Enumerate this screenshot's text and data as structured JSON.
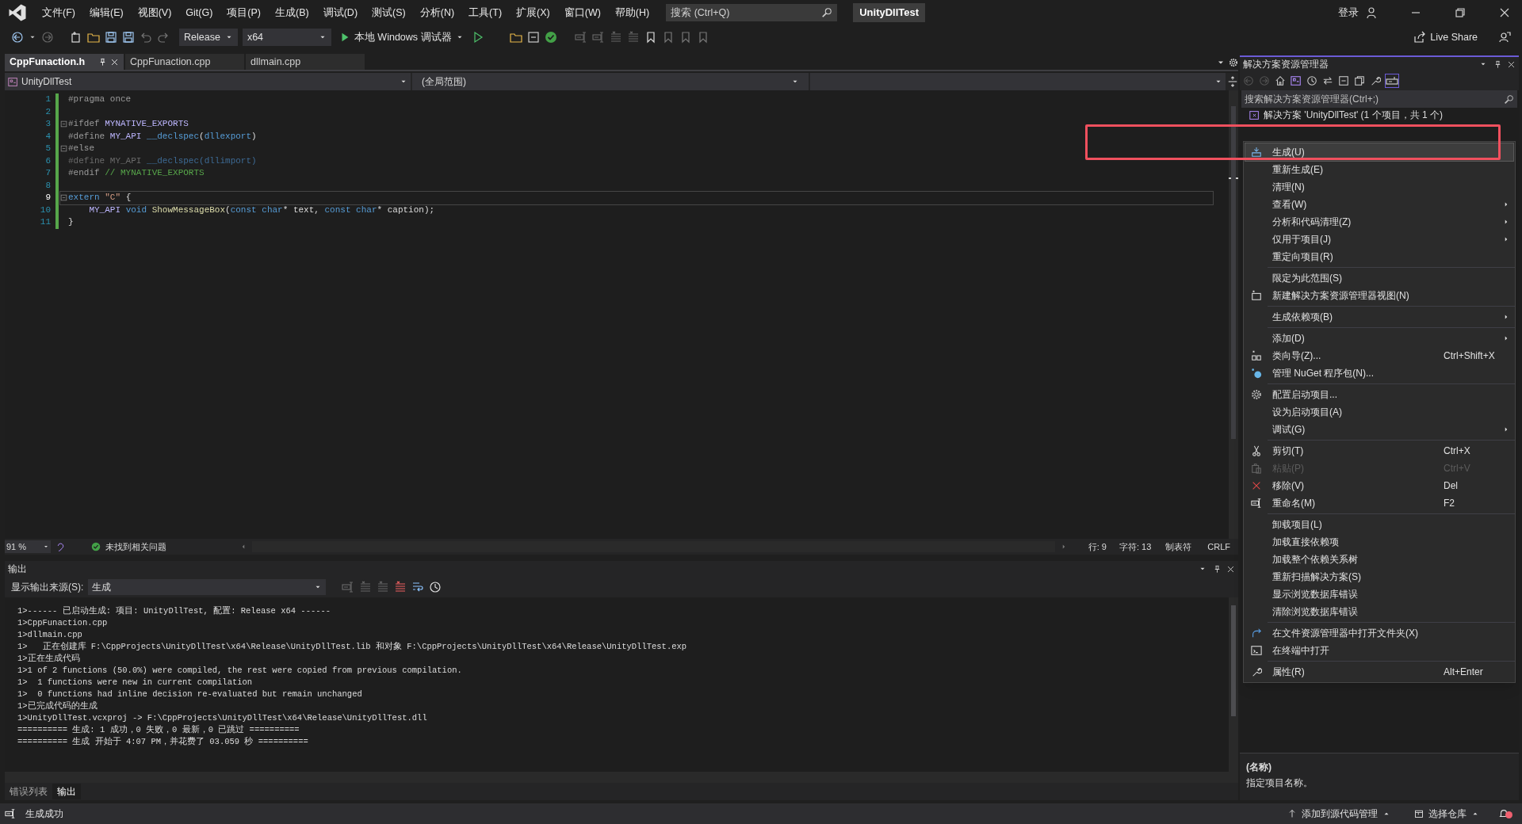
{
  "title_bar": {
    "menus": [
      "文件(F)",
      "编辑(E)",
      "视图(V)",
      "Git(G)",
      "项目(P)",
      "生成(B)",
      "调试(D)",
      "测试(S)",
      "分析(N)",
      "工具(T)",
      "扩展(X)",
      "窗口(W)",
      "帮助(H)"
    ],
    "search_placeholder": "搜索 (Ctrl+Q)",
    "solution_name": "UnityDllTest",
    "sign_in": "登录"
  },
  "toolbar": {
    "configuration": "Release",
    "platform": "x64",
    "run_target": "本地 Windows 调试器",
    "live_share": "Live Share"
  },
  "doc_tabs": [
    {
      "label": "CppFunaction.h",
      "selected": true
    },
    {
      "label": "CppFunaction.cpp",
      "selected": false
    },
    {
      "label": "dllmain.cpp",
      "selected": false
    }
  ],
  "nav_bar": {
    "project": "UnityDllTest",
    "scope": "(全局范围)"
  },
  "code": [
    {
      "number": "1",
      "current": false,
      "fold": false,
      "segments": [
        {
          "kind": "pre",
          "text": "#pragma once"
        }
      ]
    },
    {
      "number": "2",
      "current": false,
      "fold": false
    },
    {
      "number": "3",
      "current": false,
      "fold": true,
      "segments": [
        {
          "kind": "pre",
          "text": "#ifdef "
        },
        {
          "kind": "macro",
          "text": "MYNATIVE_EXPORTS"
        }
      ]
    },
    {
      "number": "4",
      "current": false,
      "fold": false,
      "segments": [
        {
          "kind": "pre",
          "text": "#define "
        },
        {
          "kind": "macro",
          "text": "MY_API "
        },
        {
          "kind": "kw",
          "text": "__declspec"
        },
        {
          "kind": "plain",
          "text": "("
        },
        {
          "kind": "kw",
          "text": "dllexport"
        },
        {
          "kind": "plain",
          "text": ")"
        }
      ]
    },
    {
      "number": "5",
      "current": false,
      "fold": true,
      "segments": [
        {
          "kind": "pre",
          "text": "#else"
        }
      ]
    },
    {
      "number": "6",
      "current": false,
      "fold": false,
      "segments": [
        {
          "kind": "inactive",
          "text": "#define MY_API "
        },
        {
          "kind": "inactive_kw",
          "text": "__declspec(dllimport)"
        }
      ]
    },
    {
      "number": "7",
      "current": false,
      "fold": false,
      "segments": [
        {
          "kind": "pre",
          "text": "#endif "
        },
        {
          "kind": "comment",
          "text": "// MYNATIVE_EXPORTS"
        }
      ]
    },
    {
      "number": "8",
      "current": false,
      "fold": false
    },
    {
      "number": "9",
      "current": true,
      "fold": true,
      "segments": [
        {
          "kind": "kw",
          "text": "extern "
        },
        {
          "kind": "string",
          "text": "\"C\""
        },
        {
          "kind": "plain",
          "text": " {"
        }
      ]
    },
    {
      "number": "10",
      "current": false,
      "fold": false,
      "segments": [
        {
          "kind": "macro",
          "text": "    MY_API "
        },
        {
          "kind": "kw",
          "text": "void "
        },
        {
          "kind": "func",
          "text": "ShowMessageBox"
        },
        {
          "kind": "plain",
          "text": "("
        },
        {
          "kind": "kw",
          "text": "const char"
        },
        {
          "kind": "plain",
          "text": "* text, "
        },
        {
          "kind": "kw",
          "text": "const char"
        },
        {
          "kind": "plain",
          "text": "* caption);"
        }
      ]
    },
    {
      "number": "11",
      "current": false,
      "fold": false,
      "segments": [
        {
          "kind": "plain",
          "text": "}"
        }
      ]
    }
  ],
  "editor_status": {
    "zoom": "91 %",
    "issues": "未找到相关问题",
    "line": "行: 9",
    "column": "字符: 13",
    "indent": "制表符",
    "line_ending": "CRLF"
  },
  "output": {
    "title": "输出",
    "source_label": "显示输出来源(S):",
    "source": "生成",
    "lines": [
      "1>------ 已启动生成: 项目: UnityDllTest, 配置: Release x64 ------",
      "1>CppFunaction.cpp",
      "1>dllmain.cpp",
      "1>   正在创建库 F:\\CppProjects\\UnityDllTest\\x64\\Release\\UnityDllTest.lib 和对象 F:\\CppProjects\\UnityDllTest\\x64\\Release\\UnityDllTest.exp",
      "1>正在生成代码",
      "1>1 of 2 functions (50.0%) were compiled, the rest were copied from previous compilation.",
      "1>  1 functions were new in current compilation",
      "1>  0 functions had inline decision re-evaluated but remain unchanged",
      "1>已完成代码的生成",
      "1>UnityDllTest.vcxproj -> F:\\CppProjects\\UnityDllTest\\x64\\Release\\UnityDllTest.dll",
      "========== 生成: 1 成功，0 失败，0 最新，0 已跳过 ==========",
      "========== 生成 开始于 4:07 PM，并花费了 03.059 秒 =========="
    ]
  },
  "bottom_tabs": [
    {
      "label": "错误列表",
      "selected": false
    },
    {
      "label": "输出",
      "selected": true
    }
  ],
  "status_bar": {
    "message": "生成成功",
    "source_control": "添加到源代码管理",
    "repository": "选择仓库"
  },
  "solution_explorer": {
    "title": "解决方案资源管理器",
    "search_placeholder": "搜索解决方案资源管理器(Ctrl+;)",
    "tree": [
      {
        "label": "解决方案 'UnityDllTest' (1 个项目，共 1 个)"
      }
    ]
  },
  "context_menu": [
    {
      "kind": "item",
      "label": "生成(U)",
      "selected": true,
      "disabled": false,
      "submenu": false
    },
    {
      "kind": "item",
      "label": "重新生成(E)",
      "selected": false,
      "disabled": false,
      "submenu": false
    },
    {
      "kind": "item",
      "label": "清理(N)",
      "selected": false,
      "disabled": false,
      "submenu": false
    },
    {
      "kind": "item",
      "label": "查看(W)",
      "selected": false,
      "disabled": false,
      "submenu": true
    },
    {
      "kind": "item",
      "label": "分析和代码清理(Z)",
      "selected": false,
      "disabled": false,
      "submenu": true
    },
    {
      "kind": "item",
      "label": "仅用于项目(J)",
      "selected": false,
      "disabled": false,
      "submenu": true
    },
    {
      "kind": "item",
      "label": "重定向项目(R)",
      "selected": false,
      "disabled": false,
      "submenu": false
    },
    {
      "kind": "separator"
    },
    {
      "kind": "item",
      "label": "限定为此范围(S)",
      "selected": false,
      "disabled": false,
      "submenu": false
    },
    {
      "kind": "item",
      "label": "新建解决方案资源管理器视图(N)",
      "selected": false,
      "disabled": false,
      "submenu": false
    },
    {
      "kind": "separator"
    },
    {
      "kind": "item",
      "label": "生成依赖项(B)",
      "selected": false,
      "disabled": false,
      "submenu": true
    },
    {
      "kind": "separator"
    },
    {
      "kind": "item",
      "label": "添加(D)",
      "selected": false,
      "disabled": false,
      "submenu": true
    },
    {
      "kind": "item",
      "label": "类向导(Z)...",
      "shortcut": "Ctrl+Shift+X",
      "selected": false,
      "disabled": false,
      "submenu": false
    },
    {
      "kind": "item",
      "label": "管理 NuGet 程序包(N)...",
      "selected": false,
      "disabled": false,
      "submenu": false
    },
    {
      "kind": "separator"
    },
    {
      "kind": "item",
      "label": "配置启动项目...",
      "selected": false,
      "disabled": false,
      "submenu": false
    },
    {
      "kind": "item",
      "label": "设为启动项目(A)",
      "selected": false,
      "disabled": false,
      "submenu": false
    },
    {
      "kind": "item",
      "label": "调试(G)",
      "selected": false,
      "disabled": false,
      "submenu": true
    },
    {
      "kind": "separator"
    },
    {
      "kind": "item",
      "label": "剪切(T)",
      "shortcut": "Ctrl+X",
      "selected": false,
      "disabled": false,
      "submenu": false
    },
    {
      "kind": "item",
      "label": "粘贴(P)",
      "shortcut": "Ctrl+V",
      "selected": false,
      "disabled": true,
      "submenu": false
    },
    {
      "kind": "item",
      "label": "移除(V)",
      "shortcut": "Del",
      "selected": false,
      "disabled": false,
      "submenu": false
    },
    {
      "kind": "item",
      "label": "重命名(M)",
      "shortcut": "F2",
      "selected": false,
      "disabled": false,
      "submenu": false
    },
    {
      "kind": "separator"
    },
    {
      "kind": "item",
      "label": "卸载项目(L)",
      "selected": false,
      "disabled": false,
      "submenu": false
    },
    {
      "kind": "item",
      "label": "加载直接依赖项",
      "selected": false,
      "disabled": false,
      "submenu": false
    },
    {
      "kind": "item",
      "label": "加载整个依赖关系树",
      "selected": false,
      "disabled": false,
      "submenu": false
    },
    {
      "kind": "item",
      "label": "重新扫描解决方案(S)",
      "selected": false,
      "disabled": false,
      "submenu": false
    },
    {
      "kind": "item",
      "label": "显示浏览数据库错误",
      "selected": false,
      "disabled": false,
      "submenu": false
    },
    {
      "kind": "item",
      "label": "清除浏览数据库错误",
      "selected": false,
      "disabled": false,
      "submenu": false
    },
    {
      "kind": "separator"
    },
    {
      "kind": "item",
      "label": "在文件资源管理器中打开文件夹(X)",
      "selected": false,
      "disabled": false,
      "submenu": false
    },
    {
      "kind": "item",
      "label": "在终端中打开",
      "selected": false,
      "disabled": false,
      "submenu": false
    },
    {
      "kind": "separator"
    },
    {
      "kind": "item",
      "label": "属性(R)",
      "shortcut": "Alt+Enter",
      "selected": false,
      "disabled": false,
      "submenu": false
    }
  ],
  "properties": {
    "name": "(名称)",
    "description": "指定项目名称。"
  }
}
